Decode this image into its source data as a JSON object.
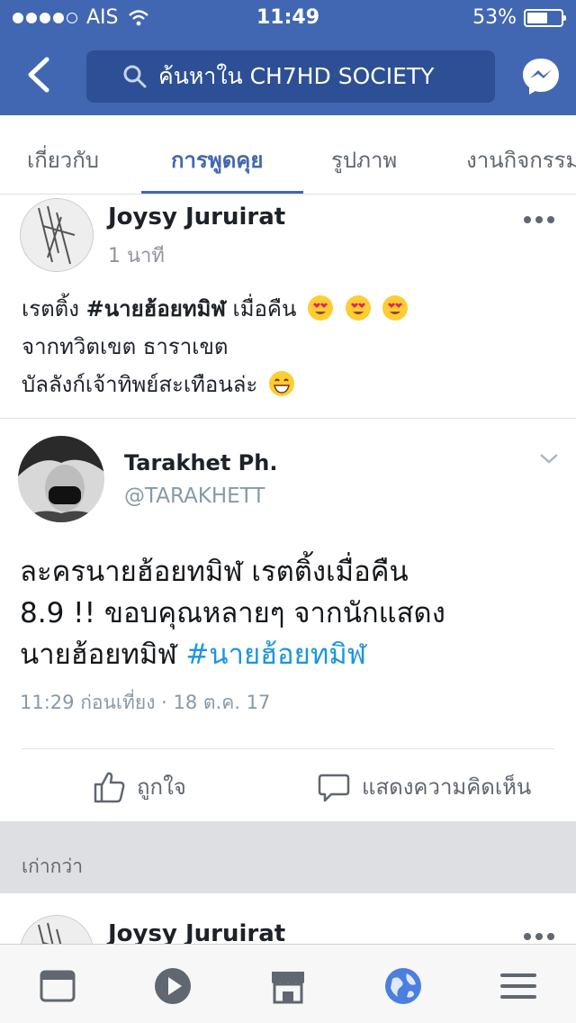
{
  "status_bar": {
    "carrier": "AIS",
    "time": "11:49",
    "battery": "53%"
  },
  "header": {
    "search_placeholder": "ค้นหาใน CH7HD SOCIETY"
  },
  "tabs": [
    {
      "label": "เกี่ยวกับ"
    },
    {
      "label": "การพูดคุย"
    },
    {
      "label": "รูปภาพ"
    },
    {
      "label": "งานกิจกรรม"
    }
  ],
  "post": {
    "author": "Joysy Juruirat",
    "time": "1 นาที",
    "line1_prefix": "เรตติ้ง ",
    "line1_hashtag": "#นายฮ้อยทมิฬ",
    "line1_suffix": " เมื่อคืน",
    "line2": "จากทวิตเขต ธาราเขต",
    "line3": "บัลลังก์เจ้าทิพย์สะเทือนล่ะ"
  },
  "tweet": {
    "author": "Tarakhet Ph.",
    "handle": "@TARAKHETT",
    "text_line1": "ละครนายฮ้อยทมิฬ เรตติ้งเมื่อคืน",
    "text_line2": "8.9 !! ขอบคุณหลายๆ จากนักแสดง",
    "text_line3_prefix": "นายฮ้อยทมิฬ ",
    "text_line3_tag": "#นายฮ้อยทมิฬ",
    "meta": "11:29 ก่อนเที่ยง · 18 ต.ค. 17"
  },
  "actions": {
    "like": "ถูกใจ",
    "comment": "แสดงความคิดเห็น"
  },
  "older": {
    "label": "เก่ากว่า"
  },
  "next_post": {
    "author": "Joysy Juruirat"
  },
  "colors": {
    "brand": "#4267b2",
    "tweet_link": "#1b95e0"
  }
}
